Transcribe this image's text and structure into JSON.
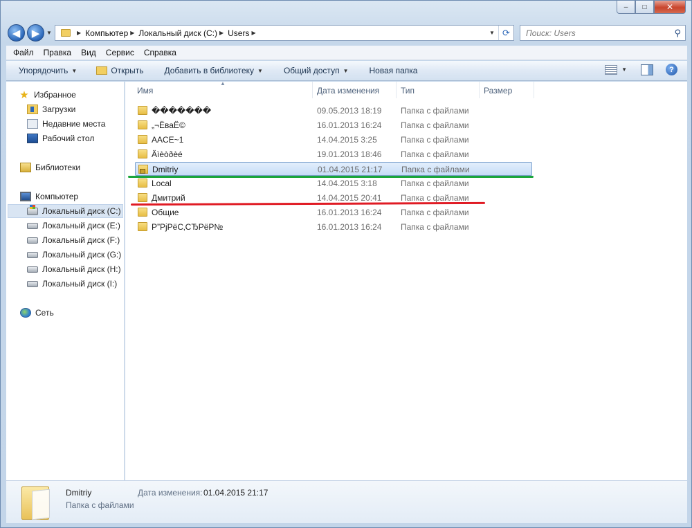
{
  "window": {
    "caption_buttons": [
      "–",
      "□",
      "✕"
    ]
  },
  "address": {
    "breadcrumbs": [
      "Компьютер",
      "Локальный диск (C:)",
      "Users"
    ],
    "search_placeholder": "Поиск: Users"
  },
  "menu": [
    "Файл",
    "Правка",
    "Вид",
    "Сервис",
    "Справка"
  ],
  "commands": {
    "organize": "Упорядочить",
    "open": "Открыть",
    "add_library": "Добавить в библиотеку",
    "share": "Общий доступ",
    "new_folder": "Новая папка"
  },
  "nav": {
    "favorites": "Избранное",
    "downloads": "Загрузки",
    "recent": "Недавние места",
    "desktop": "Рабочий стол",
    "libraries": "Библиотеки",
    "computer": "Компьютер",
    "drives": [
      "Локальный диск (C:)",
      "Локальный диск (E:)",
      "Локальный диск (F:)",
      "Локальный диск (G:)",
      "Локальный диск (H:)",
      "Локальный диск (I:)"
    ],
    "network": "Сеть"
  },
  "columns": {
    "name": "Имя",
    "date": "Дата изменения",
    "type": "Тип",
    "size": "Размер"
  },
  "rows": [
    {
      "name": "�������",
      "date": "09.05.2013 18:19",
      "type": "Папка с файлами"
    },
    {
      "name": "„¬ЁваЁ©",
      "date": "16.01.2013 16:24",
      "type": "Папка с файлами"
    },
    {
      "name": "AACE~1",
      "date": "14.04.2015 3:25",
      "type": "Папка с файлами"
    },
    {
      "name": "Äìèòðèé",
      "date": "19.01.2013 18:46",
      "type": "Папка с файлами"
    },
    {
      "name": "Dmitriy",
      "date": "01.04.2015 21:17",
      "type": "Папка с файлами"
    },
    {
      "name": "Local",
      "date": "14.04.2015 3:18",
      "type": "Папка с файлами"
    },
    {
      "name": "Дмитрий",
      "date": "14.04.2015 20:41",
      "type": "Папка с файлами"
    },
    {
      "name": "Общие",
      "date": "16.01.2013 16:24",
      "type": "Папка с файлами"
    },
    {
      "name": "Р”РјРёС‚СЂРёР№",
      "date": "16.01.2013 16:24",
      "type": "Папка с файлами"
    }
  ],
  "details": {
    "name": "Dmitriy",
    "type": "Папка с файлами",
    "date_label": "Дата изменения:",
    "date": "01.04.2015 21:17"
  },
  "colors": {
    "green_annotation": "#1aa53b",
    "red_annotation": "#e01b24",
    "selection": "#c6dcf7"
  }
}
